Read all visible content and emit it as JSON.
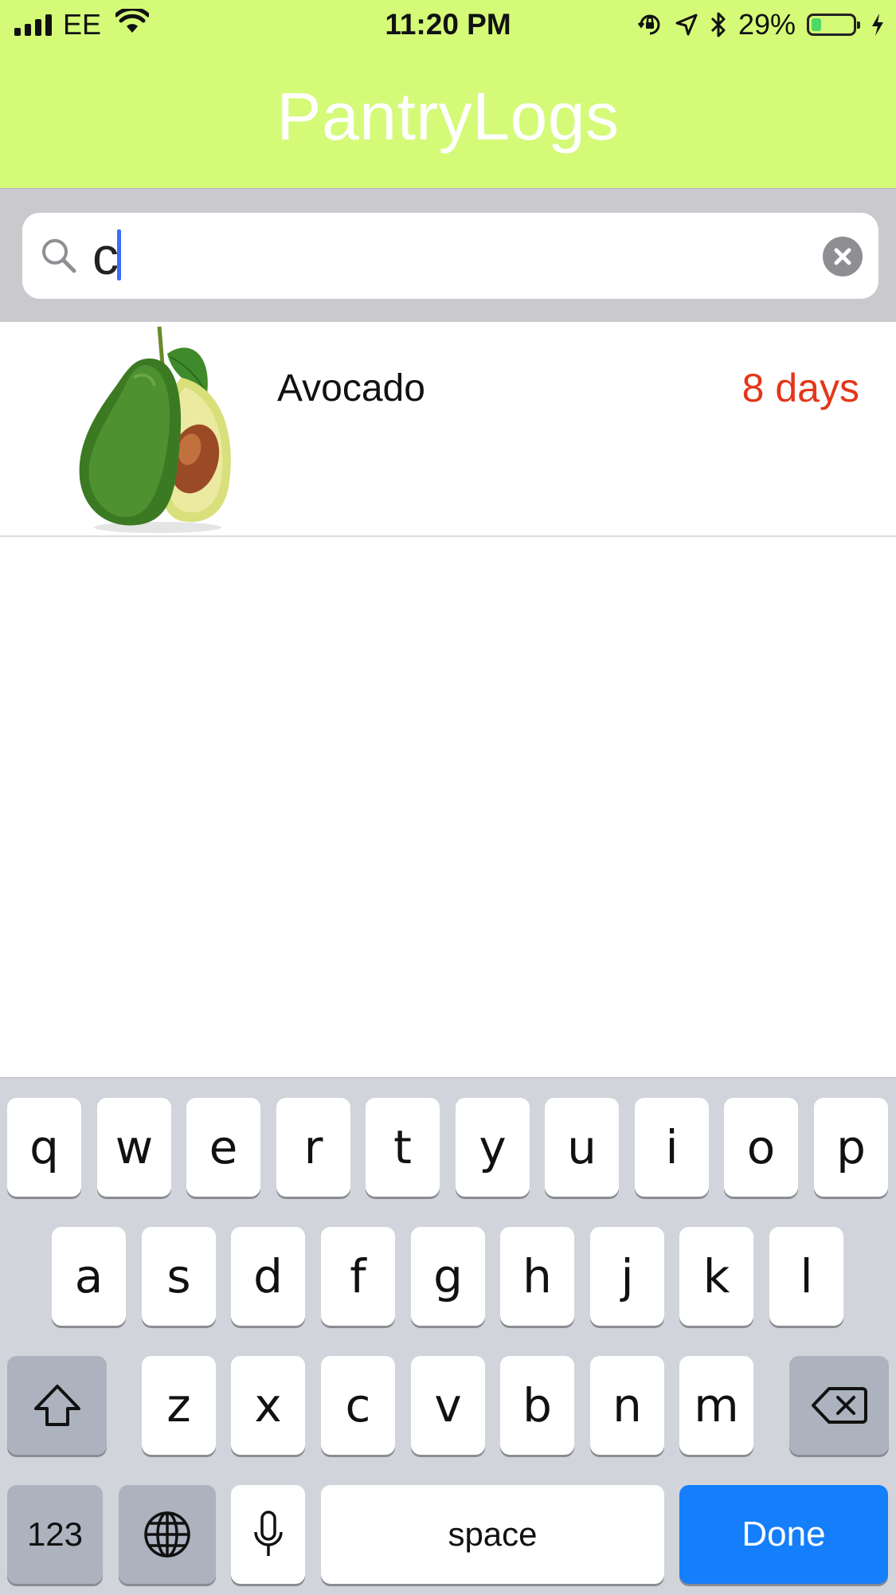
{
  "status_bar": {
    "carrier": "EE",
    "time": "11:20 PM",
    "battery_percent": "29%",
    "battery_level": 0.29,
    "icons": [
      "signal-bars-icon",
      "wifi-icon",
      "orientation-lock-icon",
      "location-arrow-icon",
      "bluetooth-icon",
      "battery-icon",
      "charging-bolt-icon"
    ]
  },
  "app": {
    "title": "PantryLogs",
    "header_color": "#d4fa78"
  },
  "search": {
    "value": "c",
    "icon": "search-icon",
    "clear_icon": "clear-icon"
  },
  "items": [
    {
      "name": "Avocado",
      "days": "8 days",
      "image": "avocado-image",
      "days_color": "#e4361a"
    }
  ],
  "keyboard": {
    "row1": [
      "q",
      "w",
      "e",
      "r",
      "t",
      "y",
      "u",
      "i",
      "o",
      "p"
    ],
    "row2": [
      "a",
      "s",
      "d",
      "f",
      "g",
      "h",
      "j",
      "k",
      "l"
    ],
    "row3": [
      "z",
      "x",
      "c",
      "v",
      "b",
      "n",
      "m"
    ],
    "numbers_label": "123",
    "space_label": "space",
    "done_label": "Done",
    "icons": [
      "shift-icon",
      "backspace-icon",
      "globe-icon",
      "microphone-icon"
    ],
    "done_color": "#147efb"
  }
}
